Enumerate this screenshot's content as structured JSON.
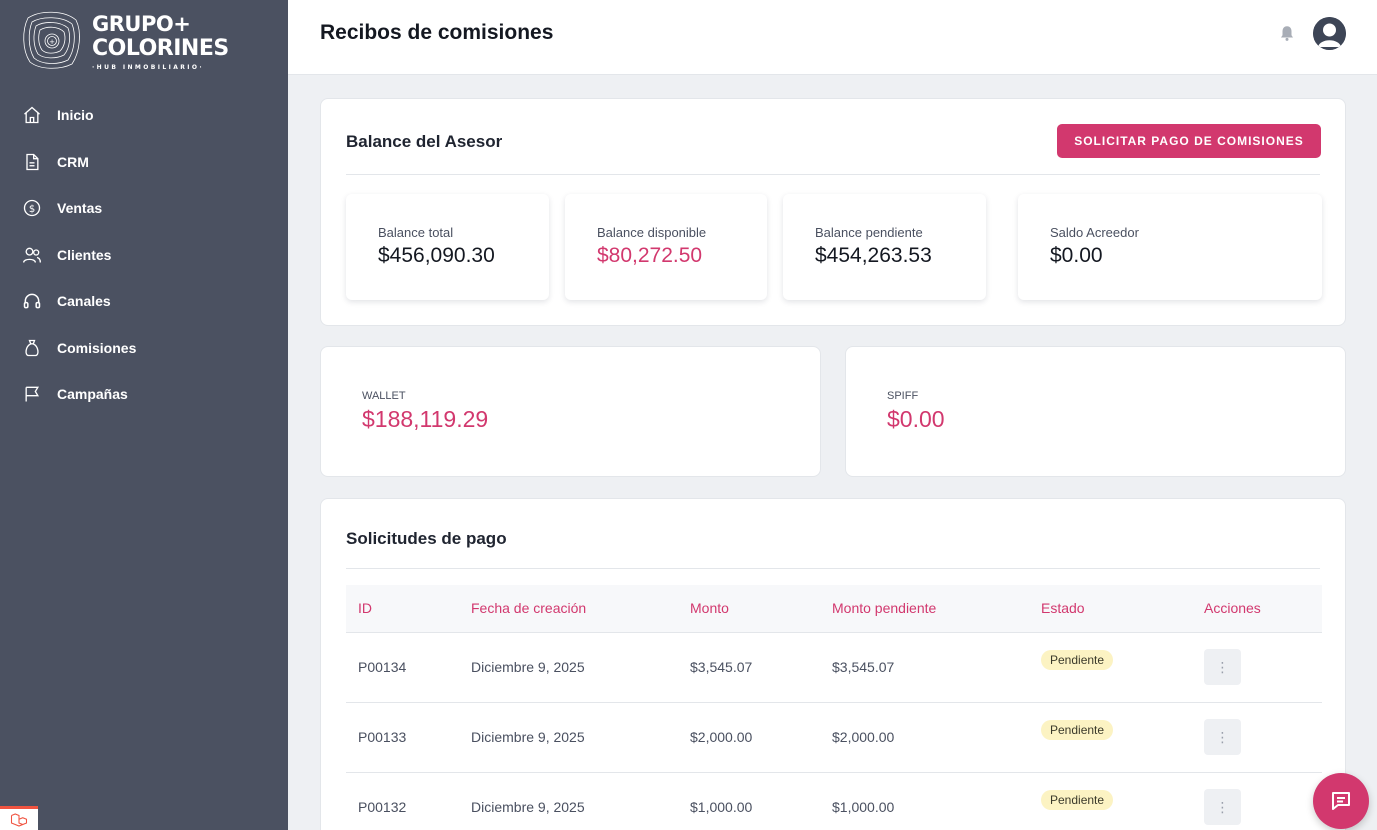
{
  "brand": {
    "line1": "GRUPO+",
    "line2": "COLORINES",
    "line3": "·HUB INMOBILIARIO·"
  },
  "sidebar": {
    "items": [
      {
        "label": "Inicio",
        "icon": "home-icon"
      },
      {
        "label": "CRM",
        "icon": "document-icon"
      },
      {
        "label": "Ventas",
        "icon": "dollar-circle-icon"
      },
      {
        "label": "Clientes",
        "icon": "users-icon"
      },
      {
        "label": "Canales",
        "icon": "headset-icon"
      },
      {
        "label": "Comisiones",
        "icon": "bag-icon"
      },
      {
        "label": "Campañas",
        "icon": "flag-icon"
      }
    ]
  },
  "header": {
    "title": "Recibos de comisiones"
  },
  "balance": {
    "title": "Balance del Asesor",
    "button_label": "SOLICITAR PAGO DE COMISIONES",
    "stats": [
      {
        "label": "Balance total",
        "value": "$456,090.30"
      },
      {
        "label": "Balance disponible",
        "value": "$80,272.50"
      },
      {
        "label": "Balance pendiente",
        "value": "$454,263.53"
      },
      {
        "label": "Saldo Acreedor",
        "value": "$0.00"
      }
    ]
  },
  "wallet": {
    "label": "WALLET",
    "value": "$188,119.29"
  },
  "spiff": {
    "label": "SPIFF",
    "value": "$0.00"
  },
  "requests": {
    "title": "Solicitudes de pago",
    "columns": [
      "ID",
      "Fecha de creación",
      "Monto",
      "Monto pendiente",
      "Estado",
      "Acciones"
    ],
    "rows": [
      {
        "id": "P00134",
        "date": "Diciembre 9, 2025",
        "amount": "$3,545.07",
        "pending": "$3,545.07",
        "status": "Pendiente"
      },
      {
        "id": "P00133",
        "date": "Diciembre 9, 2025",
        "amount": "$2,000.00",
        "pending": "$2,000.00",
        "status": "Pendiente"
      },
      {
        "id": "P00132",
        "date": "Diciembre 9, 2025",
        "amount": "$1,000.00",
        "pending": "$1,000.00",
        "status": "Pendiente"
      }
    ]
  },
  "colors": {
    "accent": "#d2386e",
    "sidebar": "#4b5161",
    "badge_bg": "#fcf3c3"
  }
}
